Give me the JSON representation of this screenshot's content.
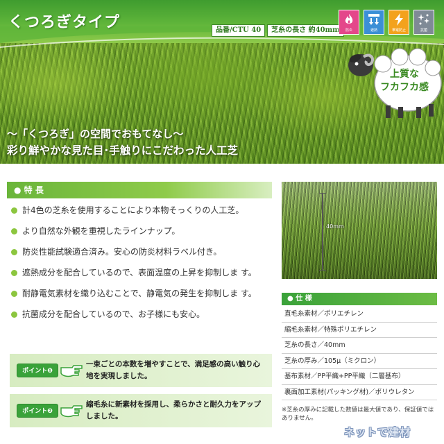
{
  "hero": {
    "title": "くつろぎタイプ",
    "product_no": "品番/CTU 40",
    "pile_length": "芝糸の長さ 約40mm",
    "badges": [
      {
        "icon": "flame-icon",
        "label": "防炎",
        "color": "#e4478a"
      },
      {
        "icon": "heat-shield-icon",
        "label": "遮熱",
        "color": "#3b8fd6"
      },
      {
        "icon": "lightning-icon",
        "label": "帯電防止",
        "color": "#f3a21d"
      },
      {
        "icon": "sparkle-icon",
        "label": "抗菌",
        "color": "#7f8a96"
      }
    ],
    "sheep_line1": "上質な",
    "sheep_line2": "フカフカ感",
    "copy1": "～「くつろぎ」の空間でおもてなし～",
    "copy2": "彩り鮮やかな見た目･手触りにこだわった人工芝"
  },
  "features": {
    "header": "● 特 長",
    "items": [
      "計4色の芝糸を使用することにより本物そっくりの人工芝。",
      "より自然な外観を重視したラインナップ。",
      "防炎性能試験適合済み。安心の防炎材料ラベル付き。",
      "遮熱成分を配合しているので、表面温度の上昇を抑制しま す。",
      "耐静電気素材を織り込むことで、静電気の発生を抑制しま す。",
      "抗菌成分を配合しているので、お子様にも安心。"
    ]
  },
  "points": [
    {
      "badge": "ポイント❶",
      "text": "一束ごとの本数を増やすことで、満足感の高い触り心 地を実現しました。"
    },
    {
      "badge": "ポイント❷",
      "text": "縮毛糸に新素材を採用し、柔らかさと耐久力をアップ しました。"
    }
  ],
  "photo": {
    "measure": "40mm"
  },
  "spec": {
    "header": "● 仕 様",
    "items": [
      "直毛糸素材／ポリエチレン",
      "縮毛糸素材／特殊ポリエチレン",
      "芝糸の長さ／40mm",
      "芝糸の厚み／105μ（ミクロン）",
      "基布素材／PP平織+PP平織（二層基布）",
      "裏面加工素材(パッキング材)／ポリウレタン"
    ],
    "note": "※芝糸の厚みに記載した数値は最大値であり、保証値ではありません。"
  },
  "watermark": "ネットで建材"
}
